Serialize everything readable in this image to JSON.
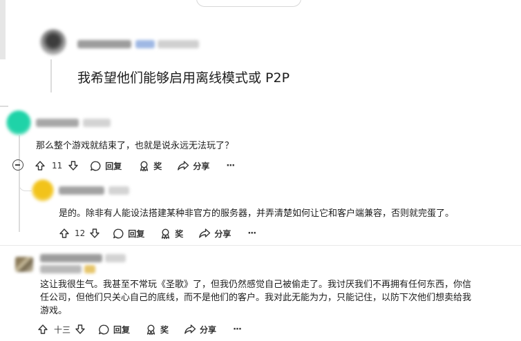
{
  "post": {
    "text": "我希望他们能够启用离线模式或 P2P"
  },
  "comments": [
    {
      "text": "那么整个游戏就结束了，也就是说永远无法玩了？",
      "score": "11",
      "reply_label": "回复",
      "award_label": "奖",
      "share_label": "分享",
      "more_label": "···"
    },
    {
      "text": "是的。除非有人能设法搭建某种非官方的服务器，并弄清楚如何让它和客户端兼容，否则就完蛋了。",
      "score": "12",
      "reply_label": "回复",
      "award_label": "奖",
      "share_label": "分享",
      "more_label": "···"
    },
    {
      "lines": [
        "这让我很生气。我甚至不常玩《圣歌》了，但我仍然感觉自己被偷走了。我讨厌我们不再拥有任何东西，你信",
        "任公司，但他们只关心自己的底线，而不是他们的客户。我对此无能为力，只能记住，以防下次他们想卖给我",
        "游戏。"
      ],
      "score": "十三",
      "reply_label": "回复",
      "award_label": "奖",
      "share_label": "分享",
      "more_label": "···"
    }
  ],
  "colors": {
    "text": "#1c1c1c",
    "muted": "#333333",
    "line": "#dcdcdc"
  }
}
